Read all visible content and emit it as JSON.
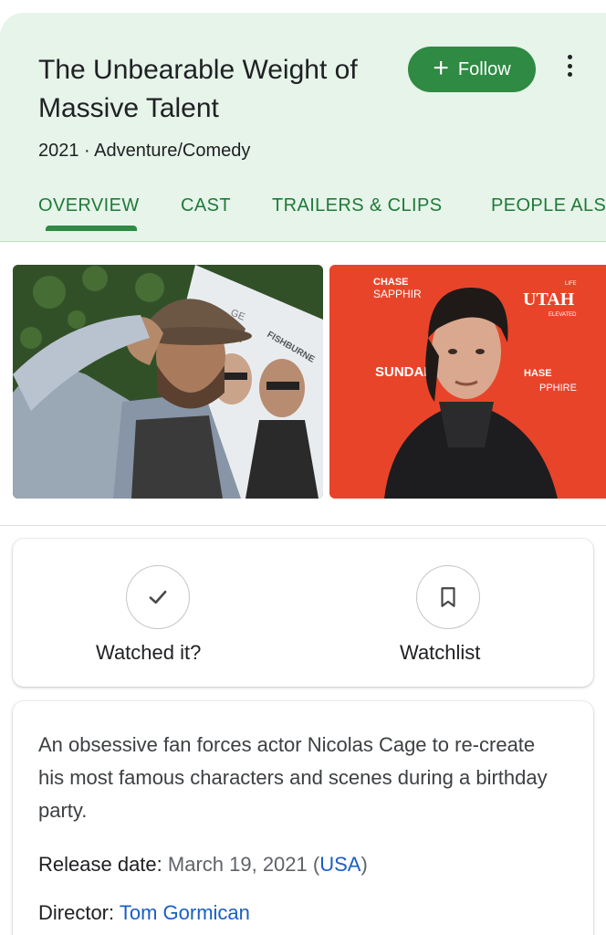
{
  "header": {
    "title": "The Unbearable Weight of Massive Talent",
    "follow_label": "Follow",
    "meta": "2021 · Adventure/Comedy",
    "tabs": [
      {
        "label": "OVERVIEW",
        "active": true
      },
      {
        "label": "CAST"
      },
      {
        "label": "TRAILERS & CLIPS"
      },
      {
        "label": "PEOPLE ALSO SEARCH FOR"
      }
    ]
  },
  "images": {
    "photo1": {
      "poster_text_1": "GE",
      "poster_text_2": "FISHBURNE"
    },
    "photo2": {
      "sponsor_1": "CHASE",
      "sponsor_2": "SAPPHIR",
      "utah": "UTAH",
      "life": "LIFE",
      "elevated": "ELEVATED",
      "sundance": "SUNDANCE",
      "sponsor_3": "HASE",
      "sponsor_4": "PPHIRE"
    }
  },
  "actions": {
    "watched_label": "Watched it?",
    "watchlist_label": "Watchlist"
  },
  "info": {
    "description": "An obsessive fan forces actor Nicolas Cage to re-create his most famous characters and scenes during a birthday party.",
    "release_label": "Release date:",
    "release_value": "March 19, 2021",
    "release_open": "(",
    "release_country": "USA",
    "release_close": ")",
    "director_label": "Director:",
    "director_value": "Tom Gormican"
  },
  "colors": {
    "header_bg": "#e6f4ea",
    "accent_green": "#2f8a43",
    "tab_text": "#1e7a37",
    "link_blue": "#1a5ec4"
  },
  "icons": [
    "plus-icon",
    "more-vert-icon",
    "check-icon",
    "bookmark-icon"
  ]
}
